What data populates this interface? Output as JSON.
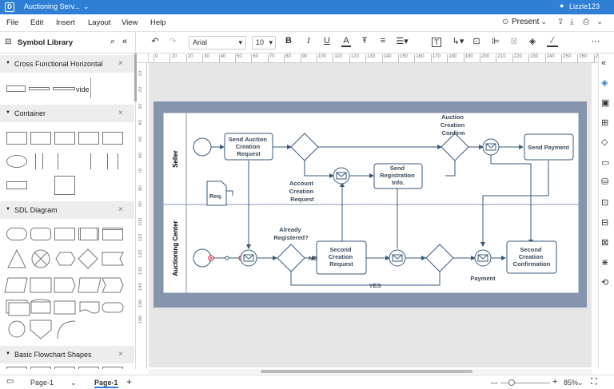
{
  "title": "Auctioning Serv...",
  "logo_glyph": "D",
  "user": "Lizzie123",
  "window_controls": [
    "—",
    "❐",
    "✕"
  ],
  "menu": [
    "File",
    "Edit",
    "Insert",
    "Layout",
    "View",
    "Help"
  ],
  "present": "Present",
  "toolbar": {
    "font": "Arial",
    "size": "10"
  },
  "panel_title": "Symbol Library",
  "sections": [
    "Cross Functional Horizontal",
    "Container",
    "SDL Diagram",
    "Basic Flowchart Shapes"
  ],
  "cfh_shape_label": "vide",
  "ruler_h": [
    "0",
    "10",
    "20",
    "30",
    "40",
    "50",
    "60",
    "70",
    "80",
    "90",
    "100",
    "110",
    "120",
    "130",
    "140",
    "150",
    "160",
    "170",
    "180",
    "190",
    "200",
    "210",
    "220",
    "230",
    "240",
    "250",
    "260",
    "270"
  ],
  "ruler_v": [
    "10",
    "20",
    "30",
    "40",
    "50",
    "60",
    "70",
    "80",
    "90",
    "100",
    "110",
    "120",
    "130",
    "140",
    "150",
    "160"
  ],
  "diagram": {
    "lane_seller": "Seller",
    "lane_auction": "Auctioning Center",
    "send_auction_request": [
      "Send Auction",
      "Creation",
      "Request"
    ],
    "auction_creation_confirm": [
      "Auction",
      "Creation",
      "Confirm"
    ],
    "send_payment": "Send Payment",
    "send_registration": [
      "Send",
      "Registration",
      "Info."
    ],
    "account_creation_request": [
      "Account",
      "Creation",
      "Request"
    ],
    "req": "Req.",
    "already_registered": [
      "Already",
      "Registered?"
    ],
    "no": "NO",
    "yes": "YES",
    "second_creation_request": [
      "Second",
      "Creation",
      "Request"
    ],
    "second_creation_confirmation": [
      "Second",
      "Creation",
      "Confirmation"
    ],
    "payment": "Payment"
  },
  "status": {
    "page_sel": "Page-1",
    "page_tab": "Page-1",
    "add": "+",
    "zoom": "85%"
  },
  "colors": {
    "titlebar": "#2f7fd6",
    "shape_stroke": "#3a5a7a",
    "pool_border": "#8794ad",
    "accent_red": "#d0021b"
  }
}
